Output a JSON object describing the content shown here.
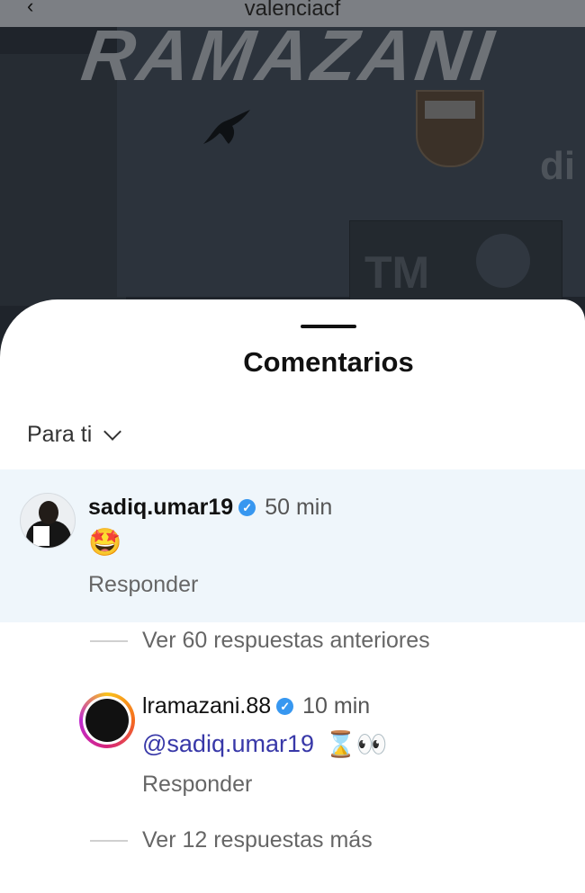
{
  "post": {
    "account": "valenciacf",
    "name_text": "RAMAZANI",
    "sponsor_text": "TM",
    "side_text": "di"
  },
  "sheet": {
    "title": "Comentarios",
    "filter_label": "Para ti"
  },
  "comments": [
    {
      "username": "sadiq.umar19",
      "verified": true,
      "time": "50 min",
      "text": "🤩",
      "reply_label": "Responder",
      "highlighted": true
    }
  ],
  "replies_toggle_previous": "Ver 60 respuestas anteriores",
  "reply": {
    "username": "lramazani.88",
    "verified": true,
    "time": "10 min",
    "mention": "@sadiq.umar19",
    "emojis": "⌛👀",
    "reply_label": "Responder"
  },
  "replies_toggle_more": "Ver 12 respuestas más",
  "colors": {
    "highlight_bg": "#eff6fb",
    "verified_blue": "#3797f0",
    "mention_blue": "#3838a8"
  }
}
